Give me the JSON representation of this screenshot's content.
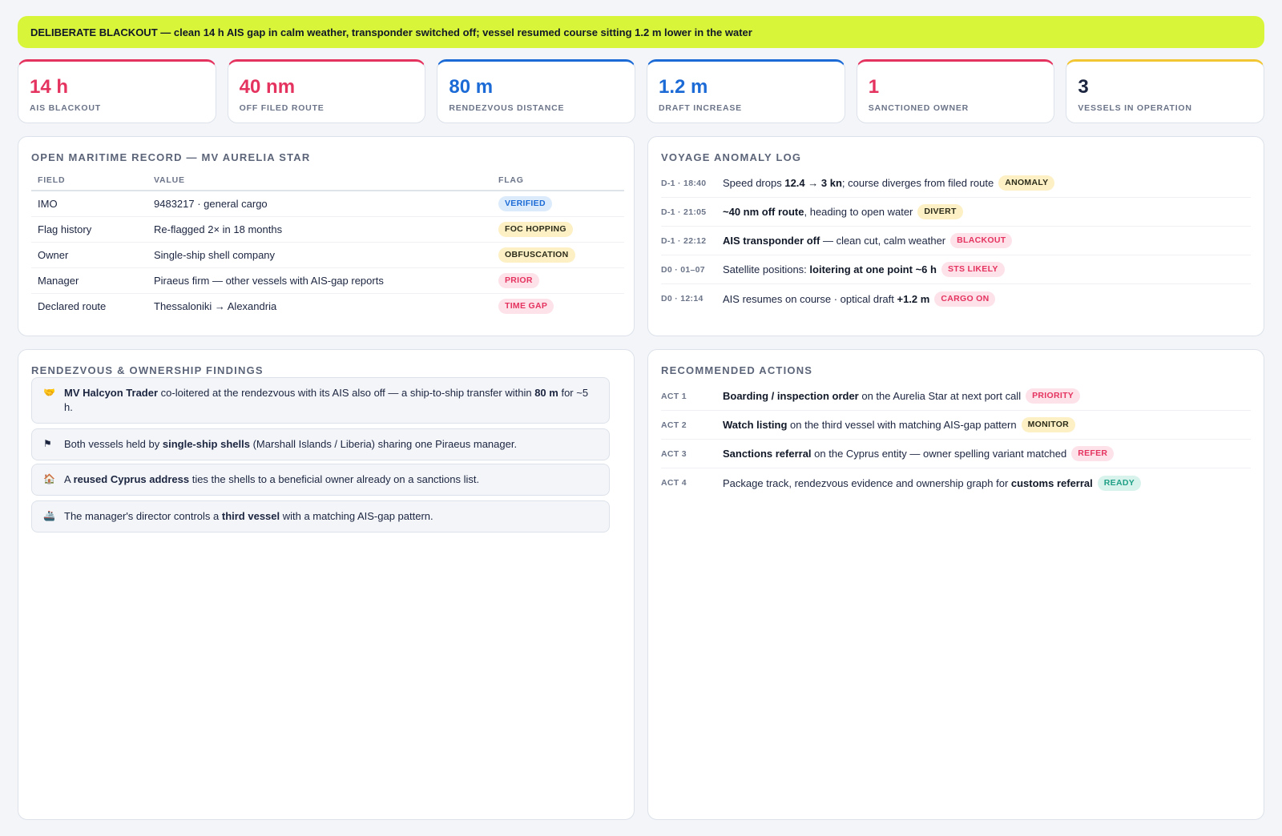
{
  "banner": "DELIBERATE BLACKOUT — clean 14 h AIS gap in calm weather, transponder switched off; vessel resumed course sitting 1.2 m lower in the water",
  "kpis": [
    {
      "value": "14 h",
      "label": "AIS BLACKOUT",
      "color": "#e5335f"
    },
    {
      "value": "40 nm",
      "label": "OFF FILED ROUTE",
      "color": "#e5335f"
    },
    {
      "value": "80 m",
      "label": "RENDEZVOUS DISTANCE",
      "color": "#1b6ad6"
    },
    {
      "value": "1.2 m",
      "label": "DRAFT INCREASE",
      "color": "#1b6ad6"
    },
    {
      "value": "1",
      "label": "SANCTIONED OWNER",
      "color": "#e5335f"
    },
    {
      "value": "3",
      "label": "VESSELS IN OPERATION",
      "color": "#f2c633"
    }
  ],
  "record": {
    "title": "OPEN MARITIME RECORD — MV AURELIA STAR",
    "headers": [
      "FIELD",
      "VALUE",
      "FLAG"
    ],
    "rows": [
      {
        "field": "IMO",
        "value": "9483217 · general cargo",
        "flag": "VERIFIED"
      },
      {
        "field": "Flag history",
        "value": "Re-flagged 2× in 18 months",
        "flag": "FOC HOPPING"
      },
      {
        "field": "Owner",
        "value": "Single-ship shell company",
        "flag": "OBFUSCATION"
      },
      {
        "field": "Manager",
        "value": "Piraeus firm — other vessels with AIS-gap reports",
        "flag": "PRIOR"
      },
      {
        "field": "Declared route",
        "value": "Thessaloniki → Alexandria",
        "flag": "TIME GAP"
      }
    ]
  },
  "log": {
    "title": "VOYAGE ANOMALY LOG",
    "rows": [
      {
        "time": "D-1 · 18:40",
        "pre": "Speed drops ",
        "bold": "12.4 → 3 kn",
        "post": "; course diverges from filed route",
        "badge": "ANOMALY"
      },
      {
        "time": "D-1 · 21:05",
        "pre": "",
        "bold": "~40 nm off route",
        "post": ", heading to open water",
        "badge": "DIVERT"
      },
      {
        "time": "D-1 · 22:12",
        "pre": "",
        "bold": "AIS transponder off",
        "post": " — clean cut, calm weather",
        "badge": "BLACKOUT"
      },
      {
        "time": "D0 · 01–07",
        "pre": "Satellite positions: ",
        "bold": "loitering at one point ~6 h",
        "post": "",
        "badge": "STS LIKELY"
      },
      {
        "time": "D0 · 12:14",
        "pre": "AIS resumes on course · optical draft ",
        "bold": "+1.2 m",
        "post": "",
        "badge": "CARGO ON"
      }
    ]
  },
  "findings": {
    "title": "RENDEZVOUS & OWNERSHIP FINDINGS",
    "items": [
      {
        "icon": "handshake-icon",
        "glyph": "🤝",
        "parts": [
          [
            "b",
            "MV Halcyon Trader"
          ],
          [
            "t",
            " co-loitered at the rendezvous with its AIS also off — a ship-to-ship transfer within "
          ],
          [
            "b",
            "80 m"
          ],
          [
            "t",
            " for ~5 h."
          ]
        ]
      },
      {
        "icon": "flag-icon",
        "glyph": "⚑",
        "parts": [
          [
            "t",
            "Both vessels held by "
          ],
          [
            "b",
            "single-ship shells"
          ],
          [
            "t",
            " (Marshall Islands / Liberia) sharing one Piraeus manager."
          ]
        ]
      },
      {
        "icon": "house-icon",
        "glyph": "🏠",
        "parts": [
          [
            "t",
            "A "
          ],
          [
            "b",
            "reused Cyprus address"
          ],
          [
            "t",
            " ties the shells to a beneficial owner already on a sanctions list."
          ]
        ]
      },
      {
        "icon": "ship-icon",
        "glyph": "🚢",
        "parts": [
          [
            "t",
            "The manager's director controls a "
          ],
          [
            "b",
            "third vessel"
          ],
          [
            "t",
            " with a matching AIS-gap pattern."
          ]
        ]
      }
    ]
  },
  "actions": {
    "title": "RECOMMENDED ACTIONS",
    "rows": [
      {
        "time": "ACT 1",
        "pre": "",
        "bold": "Boarding / inspection order",
        "post": " on the Aurelia Star at next port call",
        "badge": "PRIORITY"
      },
      {
        "time": "ACT 2",
        "pre": "",
        "bold": "Watch listing",
        "post": " on the third vessel with matching AIS-gap pattern",
        "badge": "MONITOR"
      },
      {
        "time": "ACT 3",
        "pre": "",
        "bold": "Sanctions referral",
        "post": " on the Cyprus entity — owner spelling variant matched",
        "badge": "REFER"
      },
      {
        "time": "ACT 4",
        "pre": "Package track, rendezvous evidence and ownership graph for ",
        "bold": "customs referral",
        "post": "",
        "badge": "READY"
      }
    ]
  },
  "colors": {
    "accent_lime": "#d9f53a",
    "danger": "#e5335f",
    "info": "#1b6ad6",
    "warn": "#f2c633",
    "ok": "#1f9f85"
  }
}
